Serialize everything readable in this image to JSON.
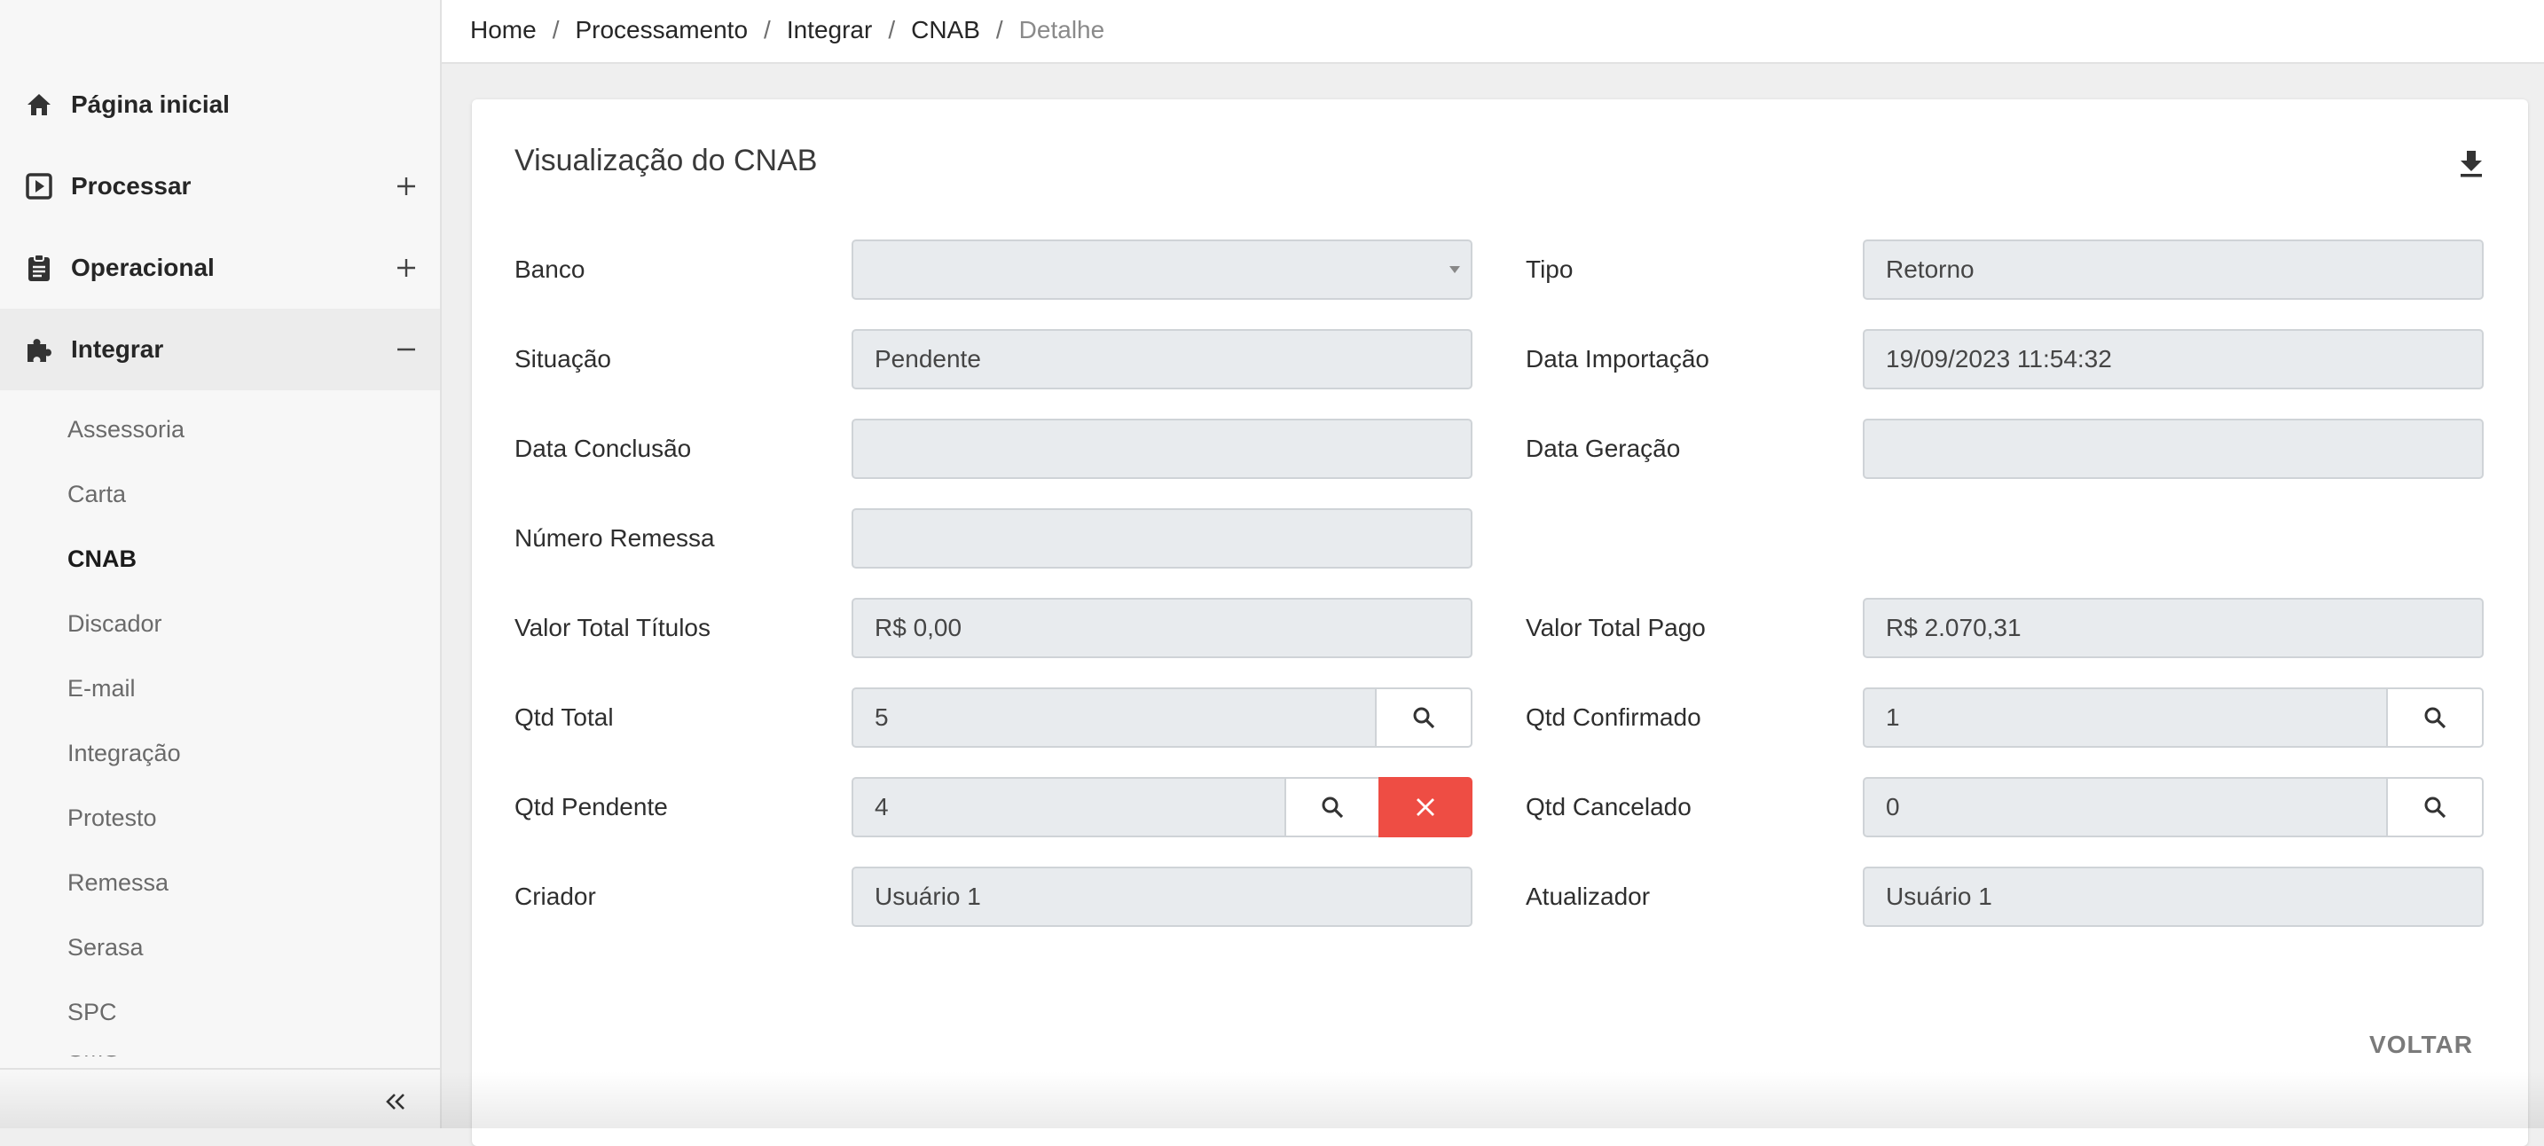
{
  "sidebar": {
    "menu": [
      {
        "label": "Página inicial",
        "icon": "home-icon"
      },
      {
        "label": "Processar",
        "icon": "play-square-icon",
        "toggle": "+"
      },
      {
        "label": "Operacional",
        "icon": "clipboard-icon",
        "toggle": "+"
      },
      {
        "label": "Integrar",
        "icon": "puzzle-icon",
        "toggle": "−"
      }
    ],
    "submenu": [
      "Assessoria",
      "Carta",
      "CNAB",
      "Discador",
      "E-mail",
      "Integração",
      "Protesto",
      "Remessa",
      "Serasa",
      "SPC",
      "SMS"
    ],
    "current_submenu": "CNAB",
    "collapse_icon": "double-chevron-left-icon"
  },
  "breadcrumb": [
    "Home",
    "Processamento",
    "Integrar",
    "CNAB",
    "Detalhe"
  ],
  "card": {
    "title": "Visualização do CNAB",
    "download_icon": "download-icon"
  },
  "fields": {
    "banco": {
      "label": "Banco",
      "value": ""
    },
    "tipo": {
      "label": "Tipo",
      "value": "Retorno"
    },
    "situacao": {
      "label": "Situação",
      "value": "Pendente"
    },
    "data_importacao": {
      "label": "Data Importação",
      "value": "19/09/2023 11:54:32"
    },
    "data_conclusao": {
      "label": "Data Conclusão",
      "value": ""
    },
    "data_geracao": {
      "label": "Data Geração",
      "value": ""
    },
    "numero_remessa": {
      "label": "Número Remessa",
      "value": ""
    },
    "valor_total_titulos": {
      "label": "Valor Total Títulos",
      "value": "R$ 0,00"
    },
    "valor_total_pago": {
      "label": "Valor Total Pago",
      "value": "R$ 2.070,31"
    },
    "qtd_total": {
      "label": "Qtd Total",
      "value": "5"
    },
    "qtd_confirmado": {
      "label": "Qtd Confirmado",
      "value": "1"
    },
    "qtd_pendente": {
      "label": "Qtd Pendente",
      "value": "4"
    },
    "qtd_cancelado": {
      "label": "Qtd Cancelado",
      "value": "0"
    },
    "criador": {
      "label": "Criador",
      "value": "Usuário 1"
    },
    "atualizador": {
      "label": "Atualizador",
      "value": "Usuário 1"
    }
  },
  "actions": {
    "voltar": "VOLTAR"
  },
  "colors": {
    "danger": "#ee4d44",
    "input_bg": "#e8ebee",
    "sidebar_bg": "#f7f7f7"
  }
}
